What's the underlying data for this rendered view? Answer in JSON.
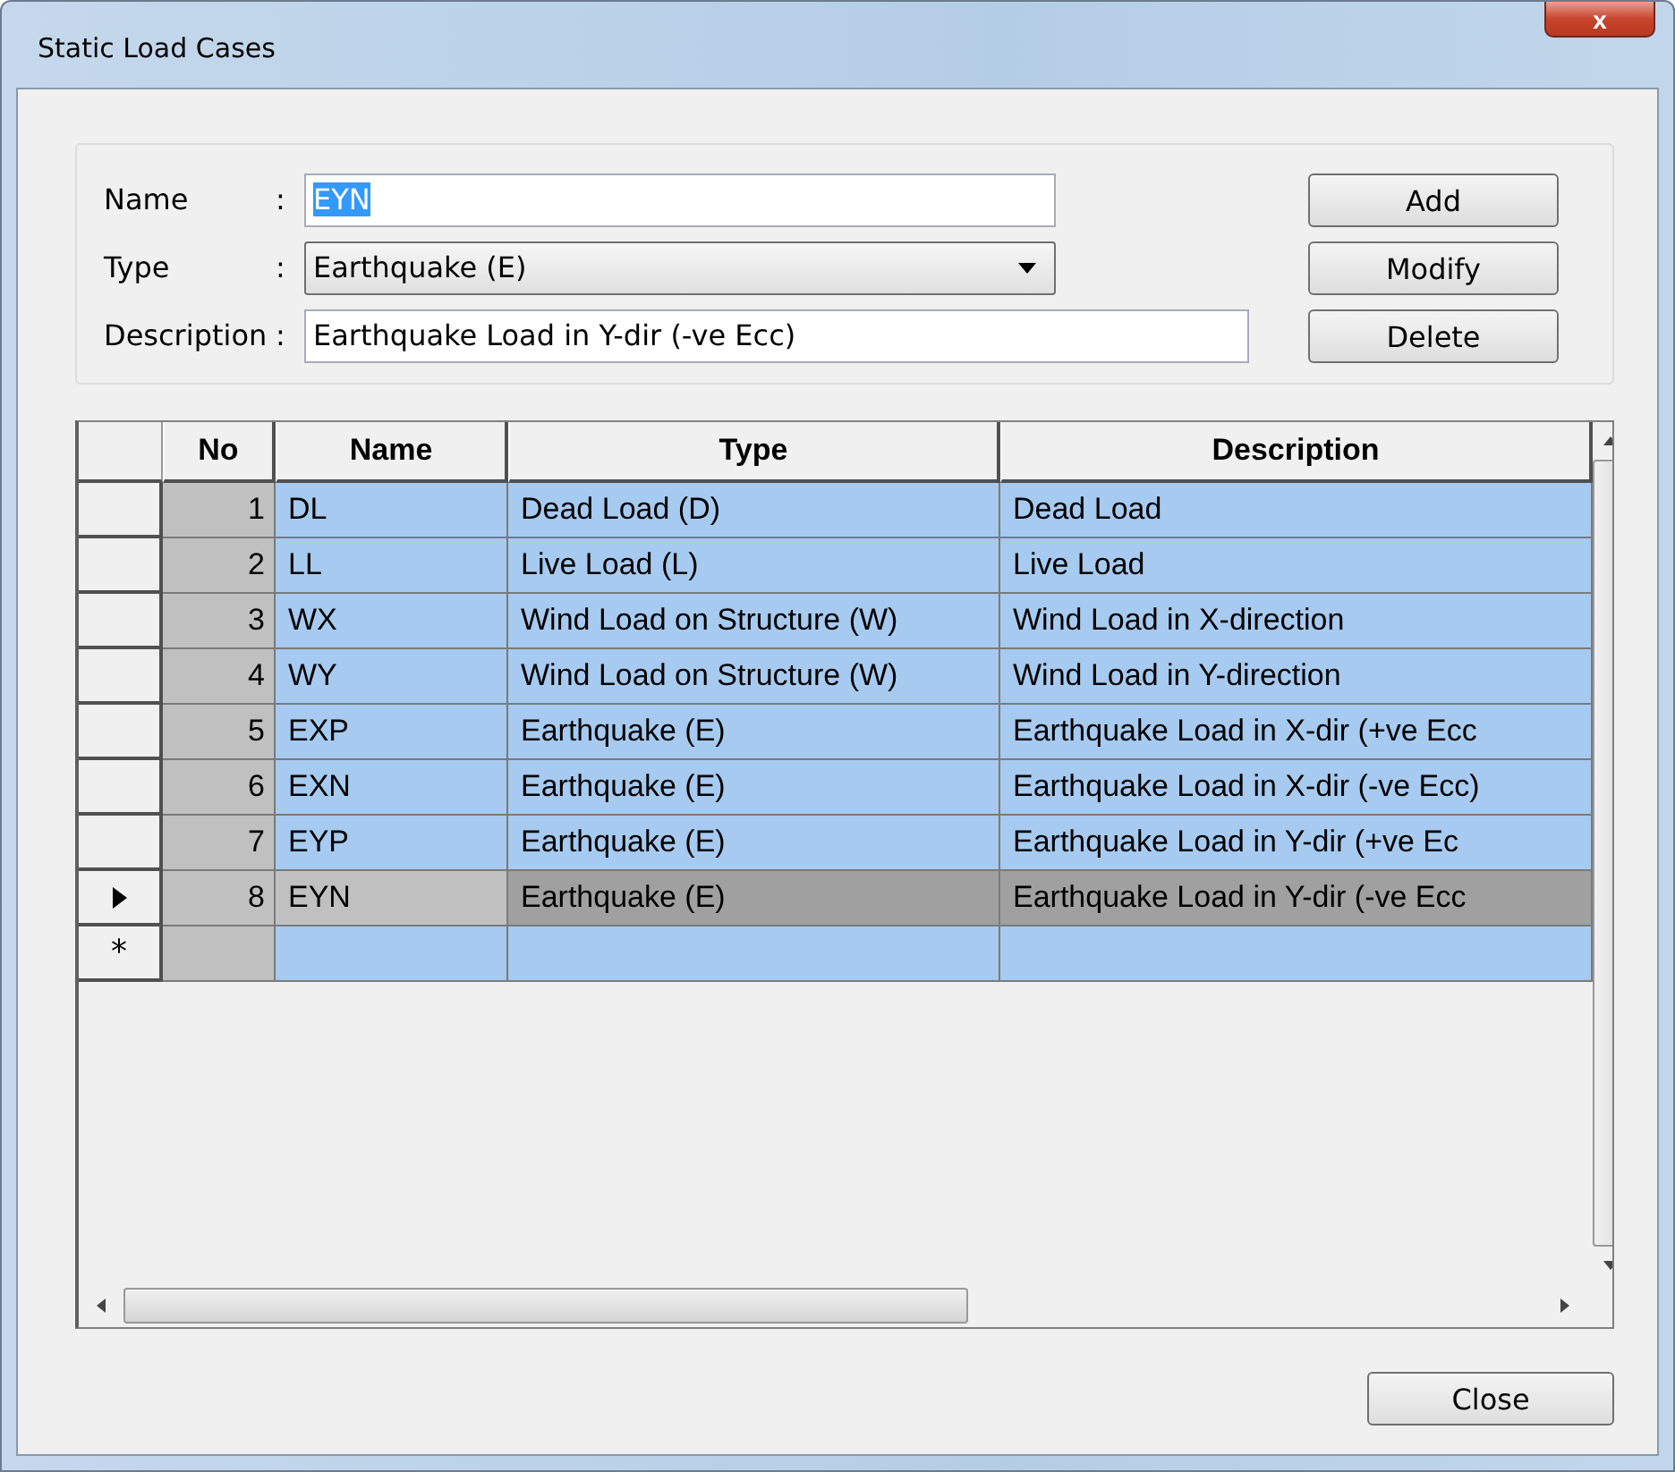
{
  "window": {
    "title": "Static Load Cases",
    "close_glyph": "x"
  },
  "form": {
    "fields": [
      {
        "kind": "text",
        "label": "Name",
        "value": "EYN",
        "selected": true
      },
      {
        "kind": "dropdown",
        "label": "Type",
        "value": "Earthquake (E)",
        "selected": false
      },
      {
        "kind": "text",
        "label": "Description",
        "value": "Earthquake Load in Y-dir (-ve Ecc)",
        "selected": false
      }
    ],
    "separator": ":",
    "buttons": [
      "Add",
      "Modify",
      "Delete"
    ]
  },
  "table": {
    "columns": [
      "No",
      "Name",
      "Type",
      "Description"
    ],
    "rows": [
      {
        "no": "1",
        "name": "DL",
        "type": "Dead Load (D)",
        "description": "Dead Load",
        "selected": false
      },
      {
        "no": "2",
        "name": "LL",
        "type": "Live Load (L)",
        "description": "Live Load",
        "selected": false
      },
      {
        "no": "3",
        "name": "WX",
        "type": "Wind Load on Structure (W)",
        "description": "Wind Load in X-direction",
        "selected": false
      },
      {
        "no": "4",
        "name": "WY",
        "type": "Wind Load on Structure (W)",
        "description": "Wind Load in Y-direction",
        "selected": false
      },
      {
        "no": "5",
        "name": "EXP",
        "type": "Earthquake (E)",
        "description": "Earthquake Load in X-dir (+ve Ecc",
        "selected": false
      },
      {
        "no": "6",
        "name": "EXN",
        "type": "Earthquake (E)",
        "description": "Earthquake Load in X-dir (-ve Ecc)",
        "selected": false
      },
      {
        "no": "7",
        "name": "EYP",
        "type": "Earthquake (E)",
        "description": "Earthquake Load in Y-dir (+ve Ec",
        "selected": false
      },
      {
        "no": "8",
        "name": "EYN",
        "type": "Earthquake (E)",
        "description": "Earthquake Load in Y-dir (-ve Ecc",
        "selected": true
      }
    ],
    "new_row_marker": "*"
  },
  "footer_buttons": [
    "Close"
  ]
}
